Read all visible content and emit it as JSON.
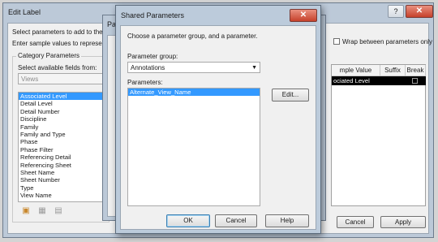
{
  "edit_label": {
    "title": "Edit Label",
    "help_btn": "?",
    "close_btn": "✕",
    "instructions_1": "Select parameters to add to the lab",
    "instructions_2": "Enter sample values to represent th",
    "category_parameters_label": "Category Parameters",
    "select_fields_label": "Select available fields from:",
    "fields_source": "Views",
    "fields": [
      "Associated Level",
      "Detail Level",
      "Detail Number",
      "Discipline",
      "Family",
      "Family and Type",
      "Phase",
      "Phase Filter",
      "Referencing Detail",
      "Referencing Sheet",
      "Sheet Name",
      "Sheet Number",
      "Type",
      "View Name"
    ],
    "selected_field": "Associated Level",
    "wrap_label": "Wrap between parameters only",
    "table_headers": [
      "mple Value",
      "Suffix",
      "Break"
    ],
    "table_row_sample": "ociated Level",
    "cancel_label": "Cancel",
    "apply_label": "Apply"
  },
  "mid_dialog": {
    "title": "Para"
  },
  "shared_parameters": {
    "title": "Shared Parameters",
    "close_btn": "✕",
    "instruction": "Choose a parameter group, and a parameter.",
    "group_label": "Parameter group:",
    "group_value": "Annotations",
    "parameters_label": "Parameters:",
    "parameters": [
      "Alternate_View_Name"
    ],
    "edit_label": "Edit...",
    "ok_label": "OK",
    "cancel_label": "Cancel",
    "help_label": "Help"
  }
}
